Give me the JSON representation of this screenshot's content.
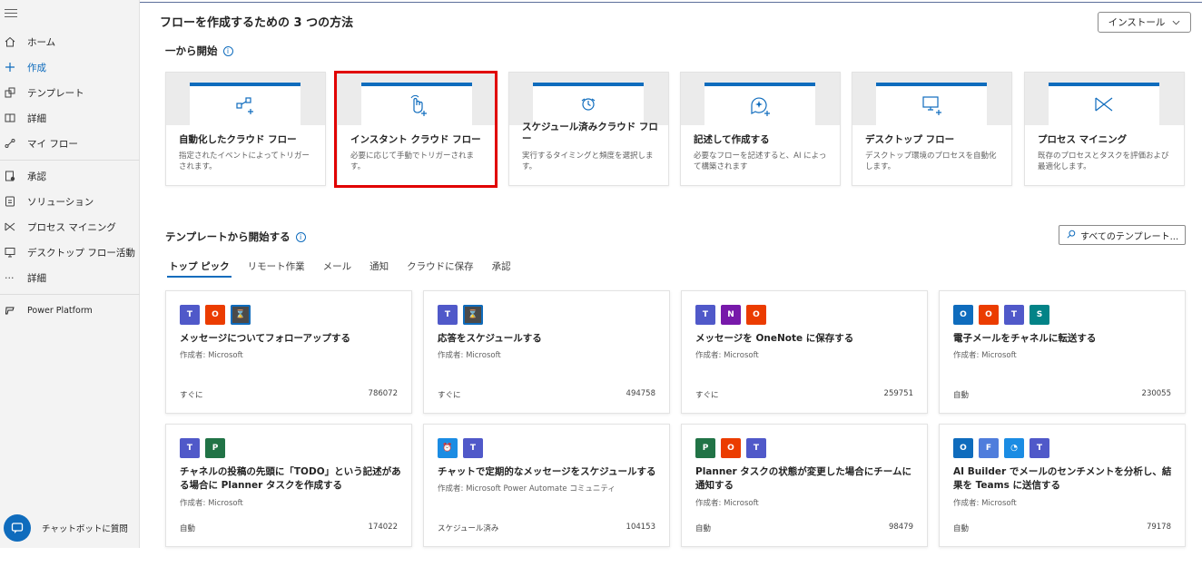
{
  "sidebar": {
    "items": [
      {
        "label": "ホーム",
        "icon": "home-icon"
      },
      {
        "label": "作成",
        "icon": "plus-icon",
        "active": true
      },
      {
        "label": "テンプレート",
        "icon": "template-icon"
      },
      {
        "label": "詳細",
        "icon": "book-icon"
      },
      {
        "label": "マイ フロー",
        "icon": "flow-icon"
      },
      {
        "label": "承認",
        "icon": "approval-icon"
      },
      {
        "label": "ソリューション",
        "icon": "solution-icon"
      },
      {
        "label": "プロセス マイニング",
        "icon": "process-mining-icon"
      },
      {
        "label": "デスクトップ フロー活動",
        "icon": "desktop-activity-icon"
      },
      {
        "label": "詳細",
        "icon": "more-icon"
      },
      {
        "label": "Power Platform",
        "icon": "power-platform-icon"
      }
    ],
    "chatbot_label": "チャットボットに質問"
  },
  "header": {
    "title": "フローを作成するための 3 つの方法",
    "install_label": "インストール"
  },
  "start_section": {
    "title": "一から開始",
    "cards": [
      {
        "title": "自動化したクラウド フロー",
        "desc": "指定されたイベントによってトリガーされます。",
        "icon": "automated-flow-icon"
      },
      {
        "title": "インスタント クラウド フロー",
        "desc": "必要に応じて手動でトリガーされます。",
        "icon": "instant-flow-icon"
      },
      {
        "title": "スケジュール済みクラウド フロー",
        "desc": "実行するタイミングと頻度を選択します。",
        "icon": "scheduled-flow-icon"
      },
      {
        "title": "記述して作成する",
        "desc": "必要なフローを記述すると、AI によって構築されます",
        "icon": "describe-flow-icon"
      },
      {
        "title": "デスクトップ フロー",
        "desc": "デスクトップ環境のプロセスを自動化します。",
        "icon": "desktop-flow-icon"
      },
      {
        "title": "プロセス マイニング",
        "desc": "既存のプロセスとタスクを評価および最適化します。",
        "icon": "process-mining-icon"
      }
    ]
  },
  "templates_section": {
    "title": "テンプレートから開始する",
    "search_label": "すべてのテンプレート...",
    "tabs": [
      "トップ ピック",
      "リモート作業",
      "メール",
      "通知",
      "クラウドに保存",
      "承認"
    ],
    "cards": [
      {
        "title": "メッセージについてフォローアップする",
        "author": "作成者: Microsoft",
        "type": "すぐに",
        "count": "786072",
        "icons": [
          {
            "name": "teams-icon",
            "color": "#5059c9",
            "glyph": "T"
          },
          {
            "name": "office-icon",
            "color": "#eb3c00",
            "glyph": "O"
          },
          {
            "name": "delay-icon",
            "color": "#4a4a4a",
            "glyph": "⌛"
          }
        ]
      },
      {
        "title": "応答をスケジュールする",
        "author": "作成者: Microsoft",
        "type": "すぐに",
        "count": "494758",
        "icons": [
          {
            "name": "teams-icon",
            "color": "#5059c9",
            "glyph": "T"
          },
          {
            "name": "delay-icon",
            "color": "#4a4a4a",
            "glyph": "⌛"
          }
        ]
      },
      {
        "title": "メッセージを OneNote に保存する",
        "author": "作成者: Microsoft",
        "type": "すぐに",
        "count": "259751",
        "icons": [
          {
            "name": "teams-icon",
            "color": "#5059c9",
            "glyph": "T"
          },
          {
            "name": "onenote-icon",
            "color": "#7719aa",
            "glyph": "N"
          },
          {
            "name": "office-icon",
            "color": "#eb3c00",
            "glyph": "O"
          }
        ]
      },
      {
        "title": "電子メールをチャネルに転送する",
        "author": "作成者: Microsoft",
        "type": "自動",
        "count": "230055",
        "icons": [
          {
            "name": "outlook-icon",
            "color": "#0f6cbd",
            "glyph": "O"
          },
          {
            "name": "office-icon",
            "color": "#eb3c00",
            "glyph": "O"
          },
          {
            "name": "teams-icon",
            "color": "#5059c9",
            "glyph": "T"
          },
          {
            "name": "sharepoint-icon",
            "color": "#038387",
            "glyph": "S"
          }
        ]
      },
      {
        "title": "チャネルの投稿の先頭に「TODO」という記述がある場合に Planner タスクを作成する",
        "author": "作成者: Microsoft",
        "type": "自動",
        "count": "174022",
        "icons": [
          {
            "name": "teams-icon",
            "color": "#5059c9",
            "glyph": "T"
          },
          {
            "name": "planner-icon",
            "color": "#217346",
            "glyph": "P"
          }
        ]
      },
      {
        "title": "チャットで定期的なメッセージをスケジュールする",
        "author": "作成者: Microsoft Power Automate コミュニティ",
        "type": "スケジュール済み",
        "count": "104153",
        "icons": [
          {
            "name": "recurrence-icon",
            "color": "#1b8ce3",
            "glyph": "⏰"
          },
          {
            "name": "teams-icon",
            "color": "#5059c9",
            "glyph": "T"
          }
        ]
      },
      {
        "title": "Planner タスクの状態が変更した場合にチームに通知する",
        "author": "作成者: Microsoft",
        "type": "自動",
        "count": "98479",
        "icons": [
          {
            "name": "planner-icon",
            "color": "#217346",
            "glyph": "P"
          },
          {
            "name": "office-icon",
            "color": "#eb3c00",
            "glyph": "O"
          },
          {
            "name": "teams-icon",
            "color": "#5059c9",
            "glyph": "T"
          }
        ]
      },
      {
        "title": "AI Builder でメールのセンチメントを分析し、結果を Teams に送信する",
        "author": "作成者: Microsoft",
        "type": "自動",
        "count": "79178",
        "icons": [
          {
            "name": "outlook-icon",
            "color": "#0f6cbd",
            "glyph": "O"
          },
          {
            "name": "forms-icon",
            "color": "#4f7ddc",
            "glyph": "F"
          },
          {
            "name": "ai-builder-icon",
            "color": "#1b8ce3",
            "glyph": "◔"
          },
          {
            "name": "teams-icon",
            "color": "#5059c9",
            "glyph": "T"
          }
        ]
      }
    ]
  },
  "colors": {
    "accent": "#0f6cbd",
    "highlight": "#e10000"
  }
}
